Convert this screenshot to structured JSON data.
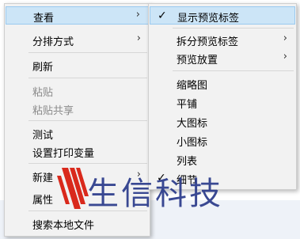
{
  "main_menu": {
    "view": "查看",
    "sort": "分排方式",
    "refresh": "刷新",
    "paste": "粘贴",
    "paste_share": "粘贴共享",
    "test": "测试",
    "print_vars": "设置打印变量",
    "new": "新建",
    "properties": "属性",
    "search_local": "搜索本地文件"
  },
  "view_submenu": {
    "show_preview_tabs": "显示预览标签",
    "split_preview_tabs": "拆分预览标签",
    "preview_position": "预览放置",
    "thumbnails": "缩略图",
    "tiles": "平铺",
    "large_icons": "大图标",
    "small_icons": "小图标",
    "list": "列表",
    "details": "细节"
  },
  "glyphs": {
    "arrow": "›",
    "check": "✓"
  },
  "watermark": {
    "text": "生信科技",
    "colors": [
      "#d9291c",
      "#2a3a8a"
    ]
  }
}
